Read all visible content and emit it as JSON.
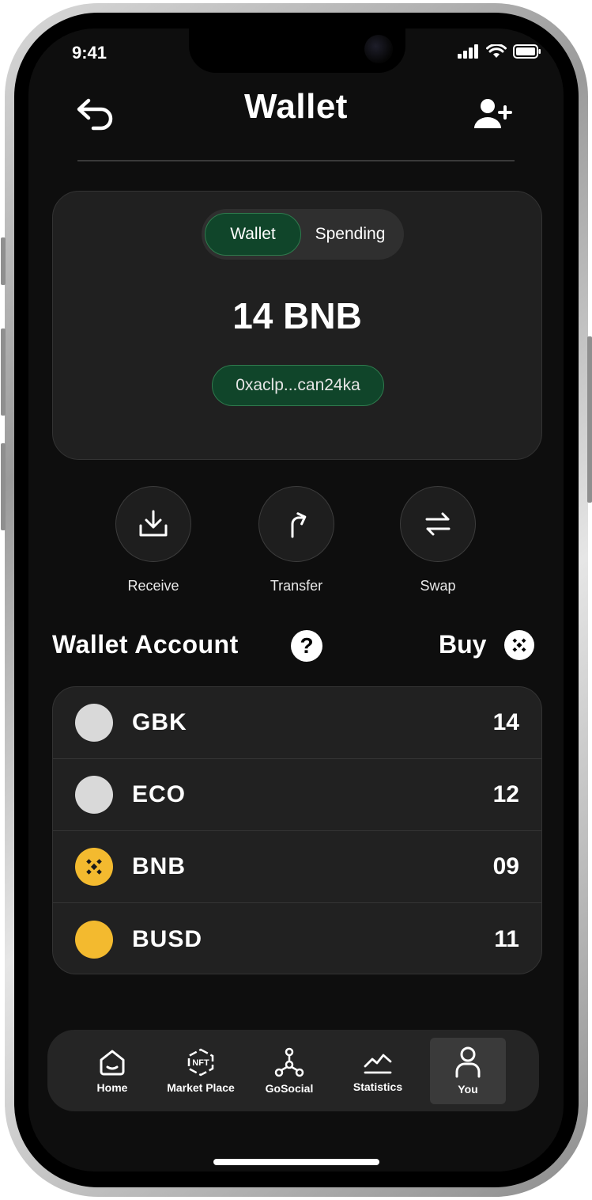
{
  "status_bar": {
    "time": "9:41"
  },
  "header": {
    "title": "Wallet"
  },
  "balance_card": {
    "tabs": [
      "Wallet",
      "Spending"
    ],
    "active_tab": "Wallet",
    "amount": "14 BNB",
    "address": "0xaclp...can24ka"
  },
  "actions": [
    {
      "label": "Receive",
      "icon": "download-icon"
    },
    {
      "label": "Transfer",
      "icon": "turn-up-right-arrow-icon"
    },
    {
      "label": "Swap",
      "icon": "swap-arrows-icon"
    }
  ],
  "wallet_account": {
    "title": "Wallet Account",
    "help_icon_text": "?",
    "buy_label": "Buy",
    "assets": [
      {
        "name": "GBK",
        "amount": "14",
        "color": "#d9d9d9",
        "icon": ""
      },
      {
        "name": "ECO",
        "amount": "12",
        "color": "#d9d9d9",
        "icon": ""
      },
      {
        "name": "BNB",
        "amount": "09",
        "color": "#f3ba2f",
        "icon": "bnb-logo-icon"
      },
      {
        "name": "BUSD",
        "amount": "11",
        "color": "#f3ba2f",
        "icon": ""
      }
    ]
  },
  "tabbar": {
    "items": [
      {
        "label": "Home",
        "icon": "home-icon"
      },
      {
        "label": "Market Place",
        "icon": "nft-icon",
        "icon_text": "NFT"
      },
      {
        "label": "GoSocial",
        "icon": "network-nodes-icon"
      },
      {
        "label": "Statistics",
        "icon": "chart-line-icon"
      },
      {
        "label": "You",
        "icon": "user-icon"
      }
    ],
    "active": "You"
  },
  "colors": {
    "background": "#0e0e0e",
    "card": "#202020",
    "accent_green": "#10452a",
    "bnb_yellow": "#f3ba2f"
  }
}
